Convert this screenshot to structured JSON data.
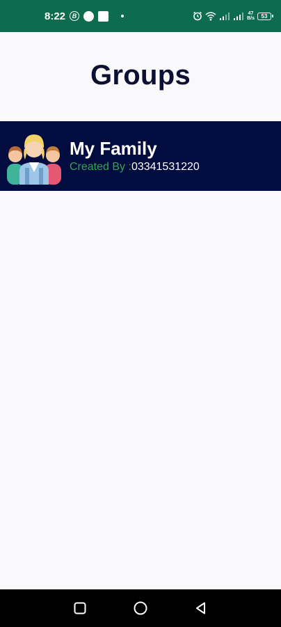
{
  "status_bar": {
    "time": "8:22",
    "b_icon_letter": "B",
    "net_speed_top": "47",
    "net_speed_bottom": "B/s",
    "battery_level": "53",
    "colors": {
      "background": "#0d6b4e"
    }
  },
  "page": {
    "title": "Groups"
  },
  "groups": [
    {
      "name": "My Family",
      "created_by_label": "Created By :",
      "created_by_value": "03341531220",
      "avatar_icon": "family-group-icon"
    }
  ],
  "nav_bar": {
    "recents_icon": "square-icon",
    "home_icon": "circle-icon",
    "back_icon": "triangle-back-icon"
  },
  "colors": {
    "title": "#0d1033",
    "card_background": "#030c3e",
    "created_label": "#2fa84f",
    "page_background": "#f9f9fb"
  }
}
